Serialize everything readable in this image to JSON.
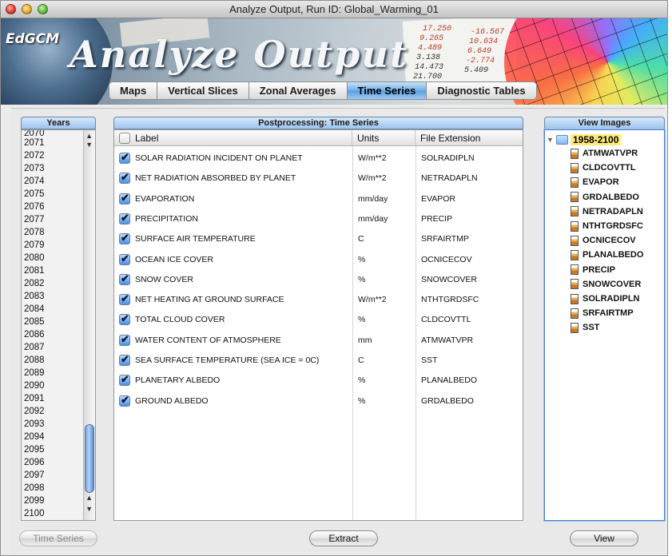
{
  "window": {
    "title": "Analyze Output, Run ID: Global_Warming_01"
  },
  "banner": {
    "brand": "EdGCM",
    "title": "Analyze Output",
    "numbers": [
      "17.250",
      "9.265",
      "4.489",
      "3.138",
      "14.473",
      "21.700",
      "-16.567",
      "10.634",
      "6.649",
      "-2.774",
      "5.409"
    ]
  },
  "tabs": [
    {
      "label": "Maps",
      "active": false
    },
    {
      "label": "Vertical Slices",
      "active": false
    },
    {
      "label": "Zonal Averages",
      "active": false
    },
    {
      "label": "Time Series",
      "active": true
    },
    {
      "label": "Diagnostic Tables",
      "active": false
    }
  ],
  "years_panel": {
    "header": "Years",
    "partial_top": "2070",
    "items": [
      "2071",
      "2072",
      "2073",
      "2074",
      "2075",
      "2076",
      "2077",
      "2078",
      "2079",
      "2080",
      "2081",
      "2082",
      "2083",
      "2084",
      "2085",
      "2086",
      "2087",
      "2088",
      "2089",
      "2090",
      "2091",
      "2092",
      "2093",
      "2094",
      "2095",
      "2096",
      "2097",
      "2098",
      "2099",
      "2100"
    ],
    "button": "Time Series"
  },
  "timeseries_panel": {
    "header": "Postprocessing: Time Series",
    "columns": {
      "label": "Label",
      "units": "Units",
      "ext": "File Extension"
    },
    "rows": [
      {
        "label": "SOLAR RADIATION INCIDENT ON PLANET",
        "units": "W/m**2",
        "ext": "SOLRADIPLN",
        "checked": true
      },
      {
        "label": "NET RADIATION ABSORBED BY PLANET",
        "units": "W/m**2",
        "ext": "NETRADAPLN",
        "checked": true
      },
      {
        "label": "EVAPORATION",
        "units": "mm/day",
        "ext": "EVAPOR",
        "checked": true
      },
      {
        "label": "PRECIPITATION",
        "units": "mm/day",
        "ext": "PRECIP",
        "checked": true
      },
      {
        "label": "SURFACE AIR TEMPERATURE",
        "units": "C",
        "ext": "SRFAIRTMP",
        "checked": true
      },
      {
        "label": "OCEAN ICE COVER",
        "units": "%",
        "ext": "OCNICECOV",
        "checked": true
      },
      {
        "label": "SNOW COVER",
        "units": "%",
        "ext": "SNOWCOVER",
        "checked": true
      },
      {
        "label": "NET HEATING AT GROUND SURFACE",
        "units": "W/m**2",
        "ext": "NTHTGRDSFC",
        "checked": true
      },
      {
        "label": "TOTAL CLOUD COVER",
        "units": "%",
        "ext": "CLDCOVTTL",
        "checked": true
      },
      {
        "label": "WATER CONTENT OF ATMOSPHERE",
        "units": "mm",
        "ext": "ATMWATVPR",
        "checked": true
      },
      {
        "label": "SEA SURFACE TEMPERATURE (SEA ICE = 0C)",
        "units": "C",
        "ext": "SST",
        "checked": true
      },
      {
        "label": "PLANETARY ALBEDO",
        "units": "%",
        "ext": "PLANALBEDO",
        "checked": true
      },
      {
        "label": "GROUND ALBEDO",
        "units": "%",
        "ext": "GRDALBEDO",
        "checked": true
      }
    ],
    "button": "Extract"
  },
  "images_panel": {
    "header": "View Images",
    "root": "1958-2100",
    "items": [
      "ATMWATVPR",
      "CLDCOVTTL",
      "EVAPOR",
      "GRDALBEDO",
      "NETRADAPLN",
      "NTHTGRDSFC",
      "OCNICECOV",
      "PLANALBEDO",
      "PRECIP",
      "SNOWCOVER",
      "SOLRADIPLN",
      "SRFAIRTMP",
      "SST"
    ],
    "button": "View"
  },
  "colors": {
    "accent": "#5a9edf",
    "selection": "#ffeb7a"
  }
}
